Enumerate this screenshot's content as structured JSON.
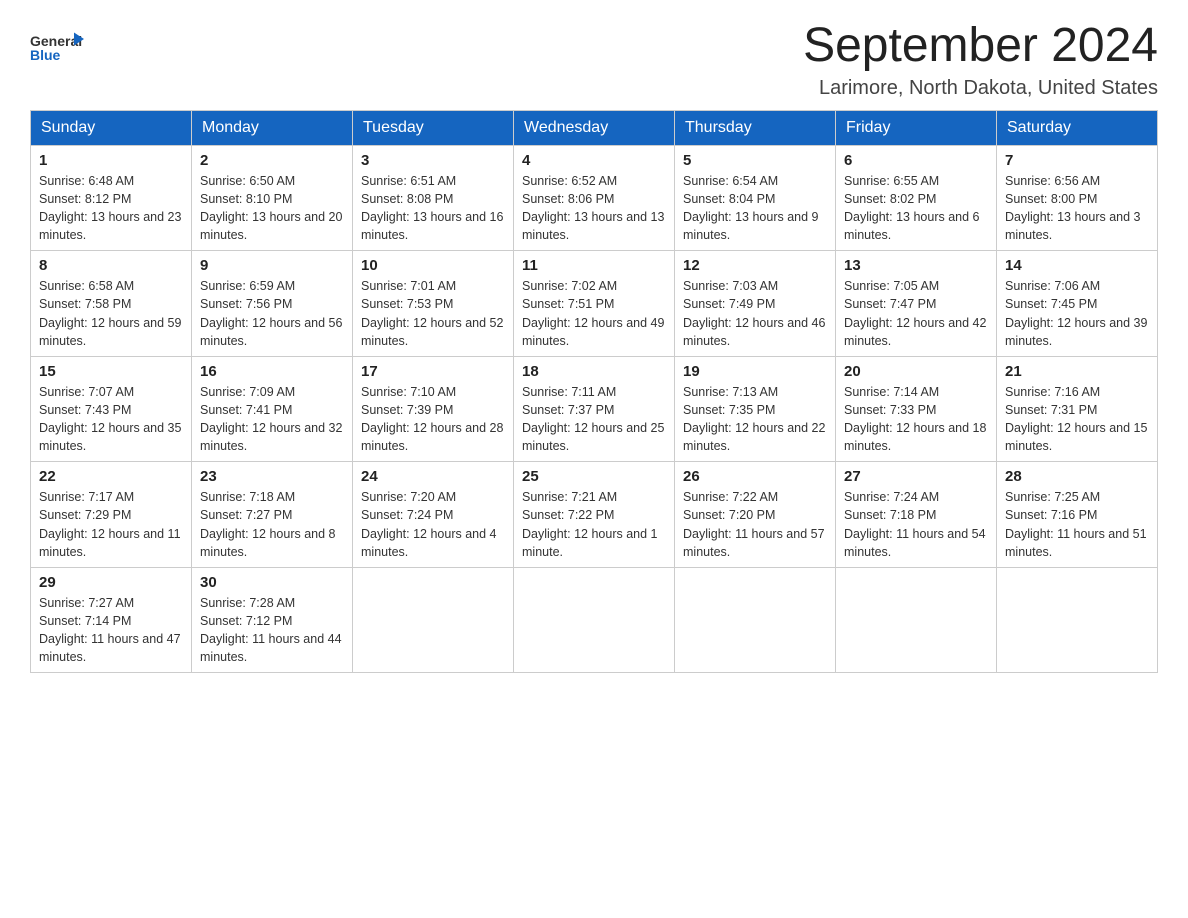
{
  "header": {
    "logo_general": "General",
    "logo_blue": "Blue",
    "month_title": "September 2024",
    "location": "Larimore, North Dakota, United States"
  },
  "days_of_week": [
    "Sunday",
    "Monday",
    "Tuesday",
    "Wednesday",
    "Thursday",
    "Friday",
    "Saturday"
  ],
  "weeks": [
    [
      {
        "day": "1",
        "sunrise": "6:48 AM",
        "sunset": "8:12 PM",
        "daylight": "13 hours and 23 minutes."
      },
      {
        "day": "2",
        "sunrise": "6:50 AM",
        "sunset": "8:10 PM",
        "daylight": "13 hours and 20 minutes."
      },
      {
        "day": "3",
        "sunrise": "6:51 AM",
        "sunset": "8:08 PM",
        "daylight": "13 hours and 16 minutes."
      },
      {
        "day": "4",
        "sunrise": "6:52 AM",
        "sunset": "8:06 PM",
        "daylight": "13 hours and 13 minutes."
      },
      {
        "day": "5",
        "sunrise": "6:54 AM",
        "sunset": "8:04 PM",
        "daylight": "13 hours and 9 minutes."
      },
      {
        "day": "6",
        "sunrise": "6:55 AM",
        "sunset": "8:02 PM",
        "daylight": "13 hours and 6 minutes."
      },
      {
        "day": "7",
        "sunrise": "6:56 AM",
        "sunset": "8:00 PM",
        "daylight": "13 hours and 3 minutes."
      }
    ],
    [
      {
        "day": "8",
        "sunrise": "6:58 AM",
        "sunset": "7:58 PM",
        "daylight": "12 hours and 59 minutes."
      },
      {
        "day": "9",
        "sunrise": "6:59 AM",
        "sunset": "7:56 PM",
        "daylight": "12 hours and 56 minutes."
      },
      {
        "day": "10",
        "sunrise": "7:01 AM",
        "sunset": "7:53 PM",
        "daylight": "12 hours and 52 minutes."
      },
      {
        "day": "11",
        "sunrise": "7:02 AM",
        "sunset": "7:51 PM",
        "daylight": "12 hours and 49 minutes."
      },
      {
        "day": "12",
        "sunrise": "7:03 AM",
        "sunset": "7:49 PM",
        "daylight": "12 hours and 46 minutes."
      },
      {
        "day": "13",
        "sunrise": "7:05 AM",
        "sunset": "7:47 PM",
        "daylight": "12 hours and 42 minutes."
      },
      {
        "day": "14",
        "sunrise": "7:06 AM",
        "sunset": "7:45 PM",
        "daylight": "12 hours and 39 minutes."
      }
    ],
    [
      {
        "day": "15",
        "sunrise": "7:07 AM",
        "sunset": "7:43 PM",
        "daylight": "12 hours and 35 minutes."
      },
      {
        "day": "16",
        "sunrise": "7:09 AM",
        "sunset": "7:41 PM",
        "daylight": "12 hours and 32 minutes."
      },
      {
        "day": "17",
        "sunrise": "7:10 AM",
        "sunset": "7:39 PM",
        "daylight": "12 hours and 28 minutes."
      },
      {
        "day": "18",
        "sunrise": "7:11 AM",
        "sunset": "7:37 PM",
        "daylight": "12 hours and 25 minutes."
      },
      {
        "day": "19",
        "sunrise": "7:13 AM",
        "sunset": "7:35 PM",
        "daylight": "12 hours and 22 minutes."
      },
      {
        "day": "20",
        "sunrise": "7:14 AM",
        "sunset": "7:33 PM",
        "daylight": "12 hours and 18 minutes."
      },
      {
        "day": "21",
        "sunrise": "7:16 AM",
        "sunset": "7:31 PM",
        "daylight": "12 hours and 15 minutes."
      }
    ],
    [
      {
        "day": "22",
        "sunrise": "7:17 AM",
        "sunset": "7:29 PM",
        "daylight": "12 hours and 11 minutes."
      },
      {
        "day": "23",
        "sunrise": "7:18 AM",
        "sunset": "7:27 PM",
        "daylight": "12 hours and 8 minutes."
      },
      {
        "day": "24",
        "sunrise": "7:20 AM",
        "sunset": "7:24 PM",
        "daylight": "12 hours and 4 minutes."
      },
      {
        "day": "25",
        "sunrise": "7:21 AM",
        "sunset": "7:22 PM",
        "daylight": "12 hours and 1 minute."
      },
      {
        "day": "26",
        "sunrise": "7:22 AM",
        "sunset": "7:20 PM",
        "daylight": "11 hours and 57 minutes."
      },
      {
        "day": "27",
        "sunrise": "7:24 AM",
        "sunset": "7:18 PM",
        "daylight": "11 hours and 54 minutes."
      },
      {
        "day": "28",
        "sunrise": "7:25 AM",
        "sunset": "7:16 PM",
        "daylight": "11 hours and 51 minutes."
      }
    ],
    [
      {
        "day": "29",
        "sunrise": "7:27 AM",
        "sunset": "7:14 PM",
        "daylight": "11 hours and 47 minutes."
      },
      {
        "day": "30",
        "sunrise": "7:28 AM",
        "sunset": "7:12 PM",
        "daylight": "11 hours and 44 minutes."
      },
      null,
      null,
      null,
      null,
      null
    ]
  ]
}
